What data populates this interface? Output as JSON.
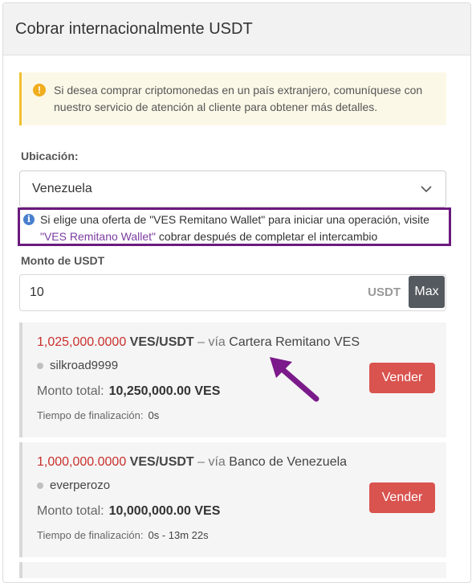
{
  "panel": {
    "title": "Cobrar internacionalmente USDT"
  },
  "alert": {
    "text": "Si desea comprar criptomonedas en un país extranjero, comuníquese con nuestro servicio de atención al cliente para obtener más detalles.",
    "icon": "warning-icon"
  },
  "location": {
    "label": "Ubicación:",
    "selected": "Venezuela"
  },
  "info": {
    "text_before": "Si elige una oferta de \"VES Remitano Wallet\" para iniciar una operación, visite ",
    "link": "\"VES Remitano Wallet\"",
    "text_after": " cobrar después de completar el intercambio",
    "icon": "info-icon"
  },
  "amount": {
    "label": "Monto de USDT",
    "value": "10",
    "unit": "USDT",
    "max_label": "Max"
  },
  "offers": [
    {
      "rate": "1,025,000.0000",
      "rate_unit": "VES/USDT",
      "via": " – vía ",
      "method": "Cartera Remitano VES",
      "seller": "silkroad9999",
      "total_label": "Monto total:",
      "total_value": "10,250,000.00 VES",
      "finish_label": "Tiempo de finalización:",
      "finish_value": "0s",
      "button": "Vender"
    },
    {
      "rate": "1,000,000.0000",
      "rate_unit": "VES/USDT",
      "via": " – vía ",
      "method": "Banco de Venezuela",
      "seller": "everperozo",
      "total_label": "Monto total:",
      "total_value": "10,000,000.00 VES",
      "finish_label": "Tiempo de finalización:",
      "finish_value": "0s - 13m 22s",
      "button": "Vender"
    }
  ],
  "colors": {
    "accent_highlight": "#6b1a7e",
    "sell_button": "#d9534f",
    "rate": "#c9302c"
  }
}
